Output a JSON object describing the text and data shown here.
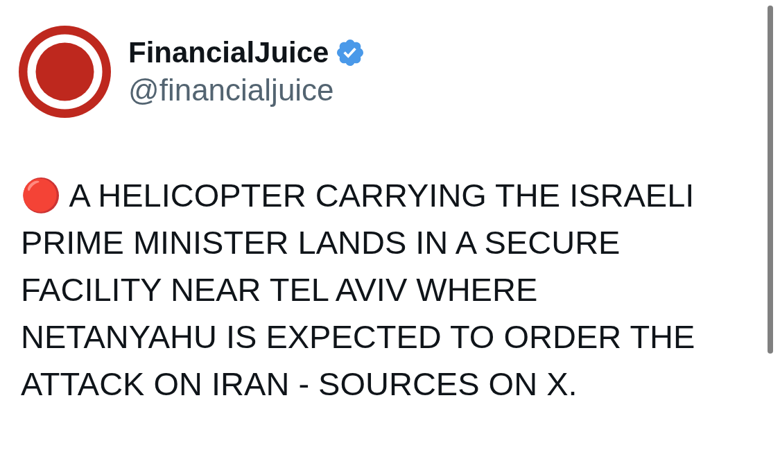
{
  "tweet": {
    "author": {
      "name": "FinancialJuice",
      "verified": true,
      "handle": "@financialjuice"
    },
    "text": "🔴 A HELICOPTER CARRYING THE ISRAELI PRIME MINISTER LANDS IN A SECURE FACILITY NEAR TEL AVIV WHERE NETANYAHU IS EXPECTED TO ORDER THE ATTACK ON IRAN - SOURCES ON X."
  }
}
